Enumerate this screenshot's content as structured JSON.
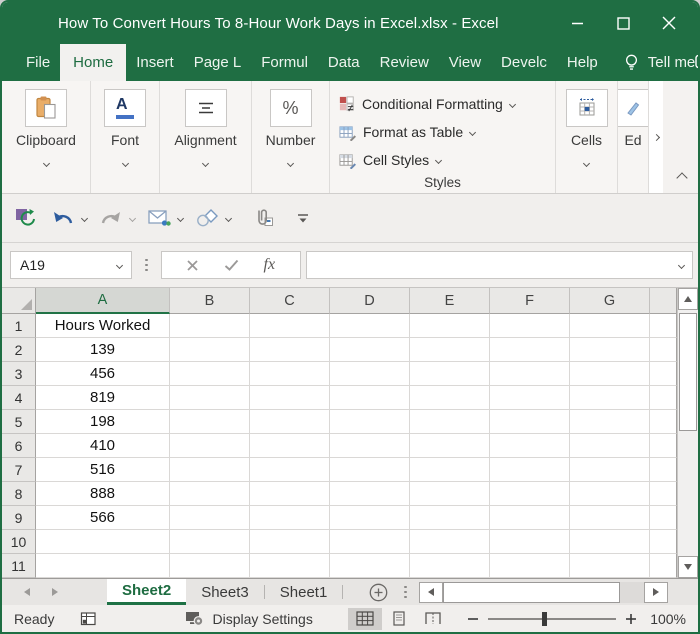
{
  "window": {
    "title": "How To Convert Hours To 8-Hour Work Days in Excel.xlsx  -  Excel"
  },
  "menu": {
    "items": [
      "File",
      "Home",
      "Insert",
      "Page L",
      "Formul",
      "Data",
      "Review",
      "View",
      "Develc",
      "Help"
    ],
    "active_item": "Home",
    "tell_me": "Tell me"
  },
  "ribbon": {
    "clipboard_label": "Clipboard",
    "font_label": "Font",
    "font_glyph": "A",
    "alignment_label": "Alignment",
    "number_label": "Number",
    "number_glyph": "%",
    "styles_label": "Styles",
    "styles_items": [
      "Conditional Formatting",
      "Format as Table",
      "Cell Styles"
    ],
    "cells_label": "Cells",
    "editing_label": "Ed"
  },
  "formula_bar": {
    "name_box_value": "A19",
    "function_label": "fx",
    "formula_value": ""
  },
  "grid": {
    "column_headers": [
      "A",
      "B",
      "C",
      "D",
      "E",
      "F",
      "G"
    ],
    "selected_column": "A",
    "rows": [
      {
        "n": "1",
        "a": "Hours Worked"
      },
      {
        "n": "2",
        "a": "139"
      },
      {
        "n": "3",
        "a": "456"
      },
      {
        "n": "4",
        "a": "819"
      },
      {
        "n": "5",
        "a": "198"
      },
      {
        "n": "6",
        "a": "410"
      },
      {
        "n": "7",
        "a": "516"
      },
      {
        "n": "8",
        "a": "888"
      },
      {
        "n": "9",
        "a": "566"
      },
      {
        "n": "10",
        "a": ""
      },
      {
        "n": "11",
        "a": ""
      }
    ]
  },
  "sheet_tabs": {
    "tabs": [
      "Sheet2",
      "Sheet3",
      "Sheet1"
    ],
    "active_tab": "Sheet2"
  },
  "status_bar": {
    "mode": "Ready",
    "display_settings": "Display Settings",
    "zoom_level": "100%"
  },
  "colors": {
    "excel_green": "#1f6e43",
    "accent_green": "#217346",
    "font_accent_blue": "#4472c4"
  },
  "icons": {
    "titlebar": [
      "minimize-icon",
      "maximize-icon",
      "close-icon"
    ],
    "menubar": [
      "lightbulb-icon",
      "chat-bubble-icon"
    ],
    "quick_access": [
      "save-sync-icon",
      "undo-icon",
      "redo-icon",
      "email-icon",
      "shapes-icon",
      "paperclip-icon",
      "customize-toolbar-icon"
    ],
    "formula_bar": [
      "cancel-icon",
      "enter-icon",
      "insert-function-icon"
    ],
    "status_bar": [
      "macro-icon",
      "display-settings-icon",
      "normal-view-icon",
      "page-layout-icon",
      "page-break-icon",
      "zoom-out-icon",
      "zoom-in-icon"
    ]
  }
}
